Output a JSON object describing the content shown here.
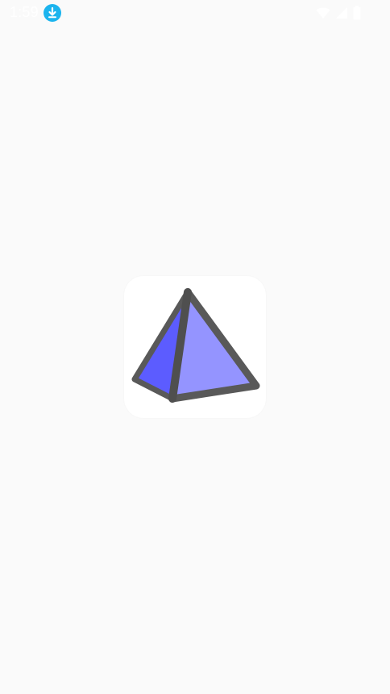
{
  "status_bar": {
    "time": "1:59",
    "icons": [
      "download-icon",
      "wifi-icon",
      "cellular-signal-icon",
      "battery-icon"
    ]
  },
  "splash": {
    "app_icon": "pyramid-logo-icon",
    "colors": {
      "background": "#fafafa",
      "tile": "#ffffff",
      "face_left": "#5c5cff",
      "face_right": "#9494ff",
      "edge": "#595959"
    }
  }
}
